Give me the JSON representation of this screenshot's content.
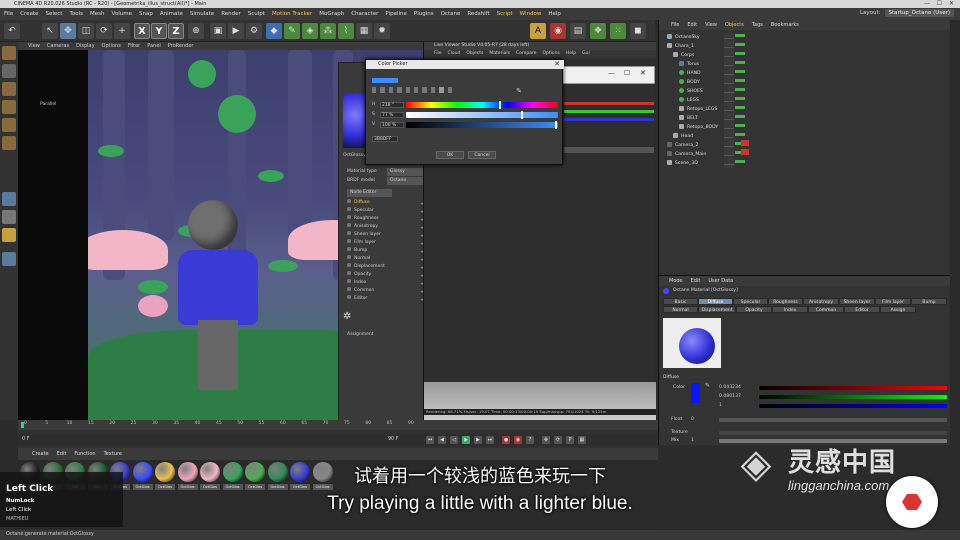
{
  "window": {
    "title": "CINEMA 4D R20.026 Studio (RC - R20) - [Geometrika_illus_struct(All)*] - Main",
    "controls": [
      "—",
      "☐",
      "✕"
    ]
  },
  "menubar": {
    "items": [
      "File",
      "Create",
      "Select",
      "Tools",
      "Mesh",
      "Volume",
      "Snap",
      "Animate",
      "Simulate",
      "Render",
      "Sculpt",
      "Motion Tracker",
      "MoGraph",
      "Character",
      "Pipeline",
      "Plugins",
      "Octane",
      "Redshift",
      "Script",
      "Window",
      "Help"
    ],
    "layout_label": "Layout:",
    "layout_value": "Startup_Octane (User)"
  },
  "toolbar": {
    "x": "X",
    "y": "Y",
    "z": "Z"
  },
  "viewport": {
    "menu": [
      "View",
      "Cameras",
      "Display",
      "Options",
      "Filter",
      "Panel",
      "ProRender"
    ],
    "projection": "Parallel",
    "grid_spacing": "Grid Spacing : 100 cm"
  },
  "material_editor": {
    "name": "OctGlossy",
    "material_type_label": "Material type",
    "material_type_value": "Glossy",
    "brdf_label": "BRDF model",
    "brdf_value": "Octane",
    "node_editor": "Node Editor",
    "channels": [
      "Diffuse",
      "Specular",
      "Roughness",
      "Anisotropy",
      "Sheen layer",
      "Film layer",
      "Bump",
      "Normal",
      "Displacement",
      "Opacity",
      "Index",
      "Common",
      "Editor"
    ],
    "assignment": "Assignment"
  },
  "live_viewer": {
    "title": "Live Viewer Studio V4.05-R7 (28 days left)",
    "menu": [
      "File",
      "Cloud",
      "Objects",
      "Materials",
      "Compare",
      "Options",
      "Help",
      "Gui"
    ],
    "status": "Rendering: 68.71%   Ms/sec: 19.07   Time: 00:00:13/00:00:19   Spp/maxspp: 704/1024   Tri: 0/125m"
  },
  "color_picker": {
    "title": "Color Picker",
    "close": "✕",
    "h_label": "H",
    "h_value": "218 °",
    "s_label": "S",
    "s_value": "77 %",
    "v_label": "V",
    "v_value": "100 %",
    "hex_value": "3B8DFF",
    "ok": "OK",
    "cancel": "Cancel",
    "hue_fraction": 0.61,
    "sat_fraction": 0.77,
    "val_fraction": 1.0,
    "swatch_color": "#3b8dff"
  },
  "object_manager": {
    "menu": [
      "File",
      "Edit",
      "View",
      "Objects",
      "Tags",
      "Bookmarks"
    ],
    "active_menu": "Objects",
    "objects": [
      {
        "name": "OctaneSky",
        "level": 0
      },
      {
        "name": "Chara_1",
        "level": 0
      },
      {
        "name": "Corps",
        "level": 1
      },
      {
        "name": "Torus",
        "level": 2
      },
      {
        "name": "HAND",
        "level": 2
      },
      {
        "name": "BODY",
        "level": 2
      },
      {
        "name": "SHOES",
        "level": 2
      },
      {
        "name": "LEGS",
        "level": 2
      },
      {
        "name": "Retopo_LEGS",
        "level": 2
      },
      {
        "name": "BELT",
        "level": 2
      },
      {
        "name": "Retopo_BODY",
        "level": 2
      },
      {
        "name": "Head",
        "level": 1
      },
      {
        "name": "Camera_2",
        "level": 0
      },
      {
        "name": "Camera_Main",
        "level": 0
      },
      {
        "name": "Scene_3D",
        "level": 0
      }
    ]
  },
  "attribute_manager": {
    "menu": [
      "Mode",
      "Edit",
      "User Data"
    ],
    "material_title": "Octane Material [OctGlossy]",
    "tabs_row1": [
      "Basic",
      "Diffuse",
      "Specular",
      "Roughness",
      "Anisotropy",
      "Sheen layer",
      "Film layer",
      "Bump"
    ],
    "tabs_row2": [
      "Normal",
      "Displacement",
      "Opacity",
      "Index",
      "Common",
      "Editor",
      "Assign"
    ],
    "active_tab": "Diffuse",
    "section": "Diffuse",
    "color_label": "Color",
    "r_value": "0.043234",
    "g_value": "0.080137",
    "b_value": "1",
    "float_label": "Float",
    "float_value": "0",
    "texture_label": "Texture",
    "mix_label": "Mix",
    "mix_value": "1"
  },
  "timeline": {
    "ticks": [
      "0",
      "5",
      "10",
      "15",
      "20",
      "25",
      "30",
      "35",
      "40",
      "45",
      "50",
      "55",
      "60",
      "65",
      "70",
      "75",
      "80",
      "85",
      "90"
    ],
    "start": "0 F",
    "end": "90 F",
    "current": "0 F"
  },
  "material_manager": {
    "menu": [
      "Create",
      "Edit",
      "Function",
      "Texture"
    ],
    "materials": [
      {
        "label": "Mat",
        "color": "#222222"
      },
      {
        "label": "Mat",
        "color": "#2a6e3a"
      },
      {
        "label": "Mat",
        "color": "#2f7d46"
      },
      {
        "label": "Mat",
        "color": "#1d5a2e"
      },
      {
        "label": "OctGlos",
        "color": "#3a3ad6"
      },
      {
        "label": "OctGlos",
        "color": "#3b4bff"
      },
      {
        "label": "OctGlos",
        "color": "#e9c04a"
      },
      {
        "label": "OctGlos",
        "color": "#f0a3bd"
      },
      {
        "label": "OctGlos",
        "color": "#f3b6c6"
      },
      {
        "label": "OctGlos",
        "color": "#3aa35a"
      },
      {
        "label": "OctGlos",
        "color": "#4caf50"
      },
      {
        "label": "OctGlos",
        "color": "#2e8b57"
      },
      {
        "label": "OctGlos",
        "color": "#3a3ad6"
      },
      {
        "label": "OctGlos",
        "color": "#888888"
      }
    ]
  },
  "key_overlay": {
    "action": "Left Click",
    "line1": "NumLock",
    "line2": "Left Click",
    "user": "MATHIEU"
  },
  "statusbar": {
    "text": "Octane:generate material:OctGlossy"
  },
  "subtitles": {
    "zh": "试着用一个较浅的蓝色来玩一下",
    "en": "Try playing a little with a lighter blue."
  },
  "watermark": {
    "cn": "灵感中国",
    "url": "lingganchina.com"
  }
}
